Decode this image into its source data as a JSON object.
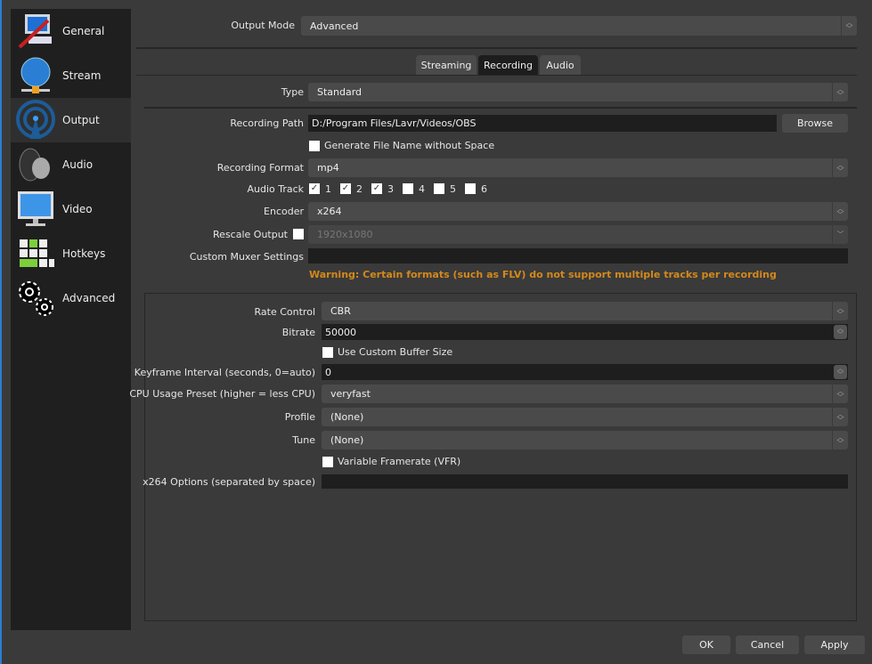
{
  "sidebar": {
    "items": [
      {
        "label": "General",
        "icon": "general-screwdriver-monitor-icon"
      },
      {
        "label": "Stream",
        "icon": "globe-network-icon"
      },
      {
        "label": "Output",
        "icon": "broadcast-antenna-icon",
        "selected": true
      },
      {
        "label": "Audio",
        "icon": "speaker-icon"
      },
      {
        "label": "Video",
        "icon": "monitor-icon"
      },
      {
        "label": "Hotkeys",
        "icon": "keyboard-icon"
      },
      {
        "label": "Advanced",
        "icon": "gears-icon"
      }
    ]
  },
  "output_mode": {
    "label": "Output Mode",
    "value": "Advanced"
  },
  "tabs": [
    {
      "label": "Streaming"
    },
    {
      "label": "Recording",
      "selected": true
    },
    {
      "label": "Audio"
    }
  ],
  "recording": {
    "type": {
      "label": "Type",
      "value": "Standard"
    },
    "path": {
      "label": "Recording Path",
      "value": "D:/Program Files/Lavr/Videos/OBS",
      "browse": "Browse"
    },
    "no_space": {
      "label": "Generate File Name without Space",
      "checked": false
    },
    "format": {
      "label": "Recording Format",
      "value": "mp4"
    },
    "audio_track": {
      "label": "Audio Track",
      "tracks": [
        {
          "label": "1",
          "checked": true
        },
        {
          "label": "2",
          "checked": true
        },
        {
          "label": "3",
          "checked": true
        },
        {
          "label": "4",
          "checked": false
        },
        {
          "label": "5",
          "checked": false
        },
        {
          "label": "6",
          "checked": false
        }
      ]
    },
    "encoder": {
      "label": "Encoder",
      "value": "x264"
    },
    "rescale": {
      "label": "Rescale Output",
      "checked": false,
      "value": "1920x1080"
    },
    "muxer": {
      "label": "Custom Muxer Settings",
      "value": ""
    },
    "warning": "Warning: Certain formats (such as FLV) do not support multiple tracks per recording",
    "warning_color": "#d4891a"
  },
  "encoder_settings": {
    "rate_control": {
      "label": "Rate Control",
      "value": "CBR"
    },
    "bitrate": {
      "label": "Bitrate",
      "value": "50000"
    },
    "buffer": {
      "label": "Use Custom Buffer Size",
      "checked": false
    },
    "keyframe": {
      "label": "Keyframe Interval (seconds, 0=auto)",
      "value": "0"
    },
    "preset": {
      "label": "CPU Usage Preset (higher = less CPU)",
      "value": "veryfast"
    },
    "profile": {
      "label": "Profile",
      "value": "(None)"
    },
    "tune": {
      "label": "Tune",
      "value": "(None)"
    },
    "vfr": {
      "label": "Variable Framerate (VFR)",
      "checked": false
    },
    "options": {
      "label": "x264 Options (separated by space)",
      "value": ""
    }
  },
  "buttons": {
    "ok": "OK",
    "cancel": "Cancel",
    "apply": "Apply"
  }
}
